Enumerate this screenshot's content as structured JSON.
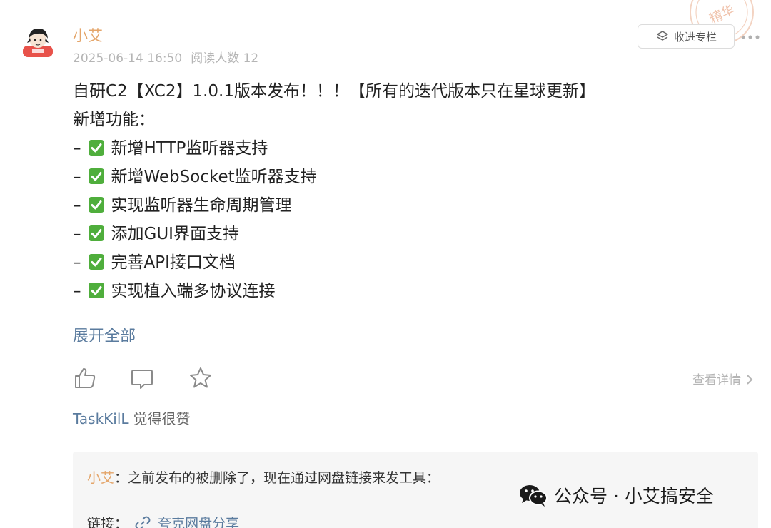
{
  "post": {
    "author": "小艾",
    "date": "2025-06-14 16:50",
    "reads": "阅读人数 12",
    "collect_label": "收进专栏",
    "featured_badge": "精华",
    "title": "自研C2【XC2】1.0.1版本发布！！！【所有的迭代版本只在星球更新】",
    "section_heading": "新增功能：",
    "features": [
      "新增HTTP监听器支持",
      "新增WebSocket监听器支持",
      "实现监听器生命周期管理",
      "添加GUI界面支持",
      "完善API接口文档",
      "实现植入端多协议连接"
    ],
    "bullet_dash": "–",
    "expand_label": "展开全部",
    "view_detail": "查看详情"
  },
  "likes": {
    "user": "TaskKilL",
    "text": "觉得很赞"
  },
  "comment": {
    "author": "小艾",
    "separator": "：",
    "text": "之前发布的被删除了，现在通过网盘链接来发工具：",
    "link_prefix": "链接：",
    "link_text": "夸克网盘分享"
  },
  "watermark": {
    "text": "公众号 · 小艾搞安全"
  },
  "colors": {
    "author": "#e4a56a",
    "link": "#5a7b9e",
    "meta": "#b5b5b5",
    "check": "#4fae3c"
  },
  "icons": [
    "like-icon",
    "comment-icon",
    "star-icon",
    "more-icon",
    "chevron-right-icon",
    "link-icon",
    "wechat-icon",
    "collect-icon"
  ]
}
